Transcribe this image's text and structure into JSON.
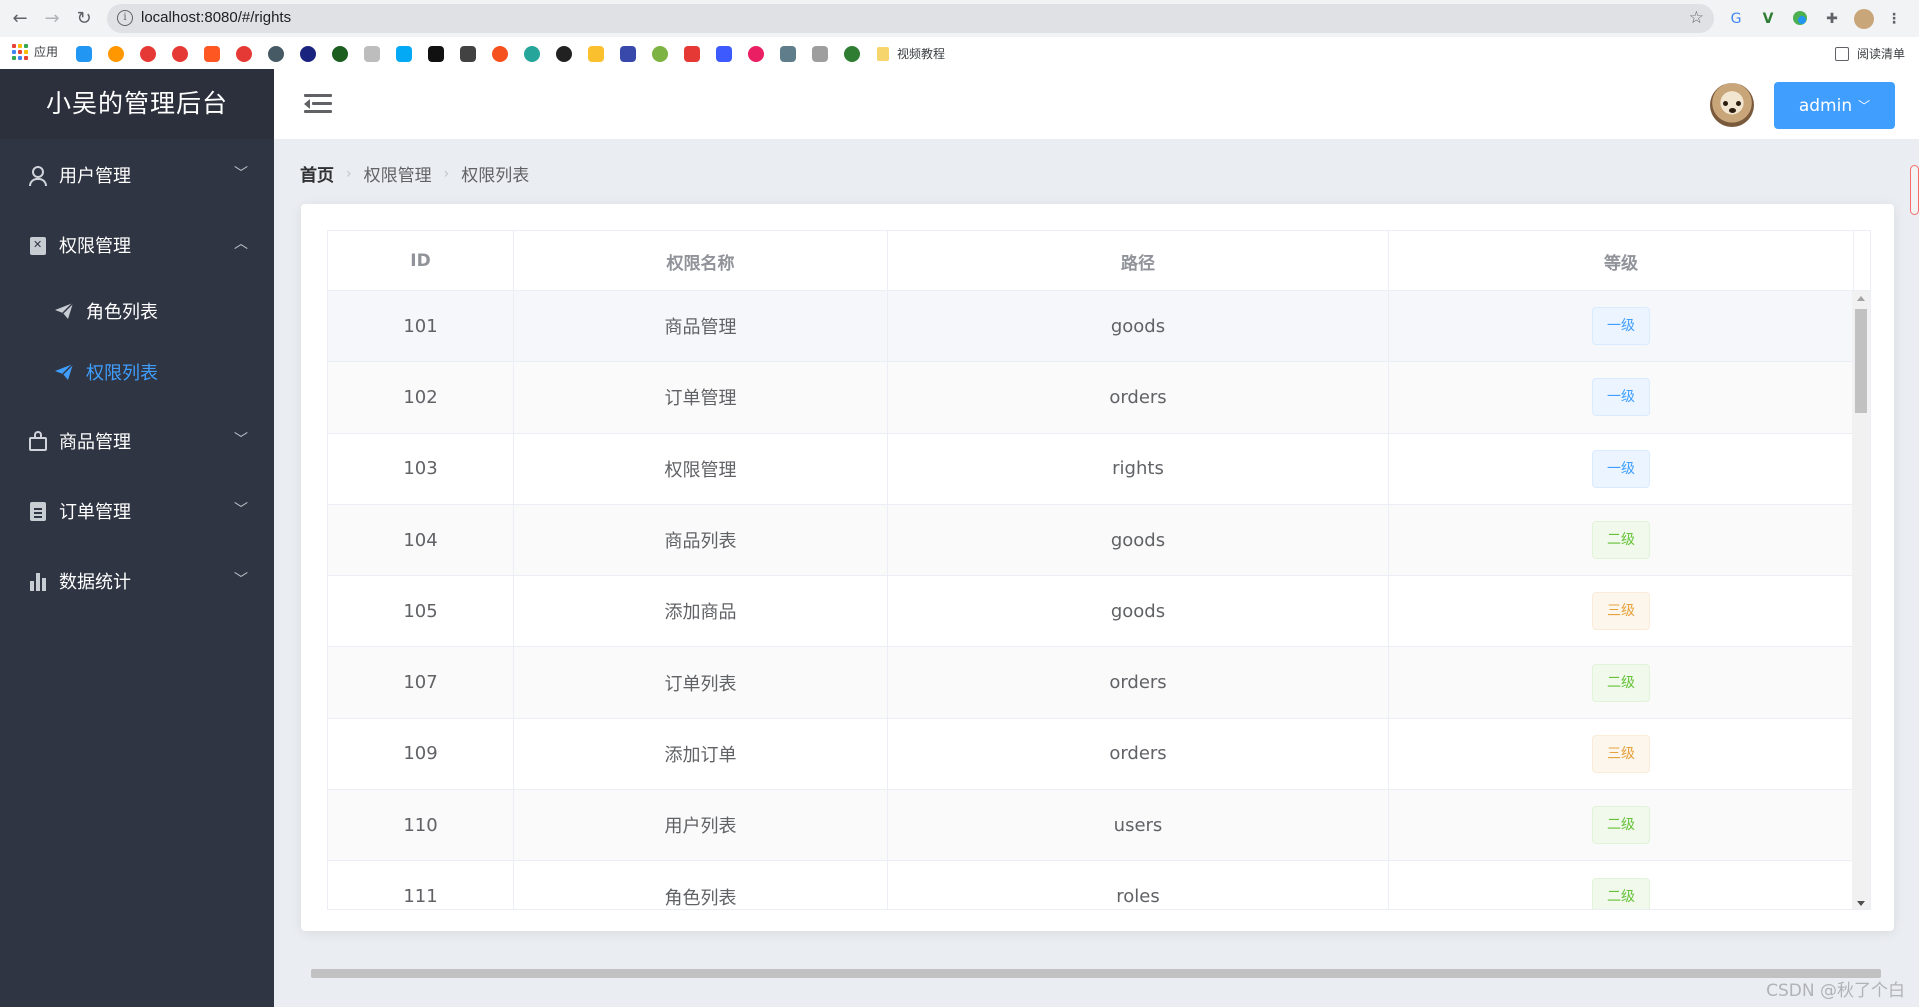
{
  "browser": {
    "url": "localhost:8080/#/rights",
    "apps_label": "应用",
    "bookmark_folder": "视频教程",
    "reading_list": "阅读清单"
  },
  "sidebar": {
    "brand": "小吴的管理后台",
    "menus": [
      {
        "label": "用户管理",
        "icon": "user-icon",
        "expanded": false
      },
      {
        "label": "权限管理",
        "icon": "clipboard-icon",
        "expanded": true,
        "children": [
          {
            "label": "角色列表",
            "icon": "paper-plane-icon",
            "active": false
          },
          {
            "label": "权限列表",
            "icon": "paper-plane-icon",
            "active": true
          }
        ]
      },
      {
        "label": "商品管理",
        "icon": "shopping-bag-icon",
        "expanded": false
      },
      {
        "label": "订单管理",
        "icon": "document-icon",
        "expanded": false
      },
      {
        "label": "数据统计",
        "icon": "bar-chart-icon",
        "expanded": false
      }
    ]
  },
  "header": {
    "user": "admin"
  },
  "breadcrumb": [
    "首页",
    "权限管理",
    "权限列表"
  ],
  "table": {
    "columns": [
      "ID",
      "权限名称",
      "路径",
      "等级"
    ],
    "rows": [
      {
        "id": "101",
        "name": "商品管理",
        "path": "goods",
        "level": "一级",
        "level_num": 1
      },
      {
        "id": "102",
        "name": "订单管理",
        "path": "orders",
        "level": "一级",
        "level_num": 1
      },
      {
        "id": "103",
        "name": "权限管理",
        "path": "rights",
        "level": "一级",
        "level_num": 1
      },
      {
        "id": "104",
        "name": "商品列表",
        "path": "goods",
        "level": "二级",
        "level_num": 2
      },
      {
        "id": "105",
        "name": "添加商品",
        "path": "goods",
        "level": "三级",
        "level_num": 3
      },
      {
        "id": "107",
        "name": "订单列表",
        "path": "orders",
        "level": "二级",
        "level_num": 2
      },
      {
        "id": "109",
        "name": "添加订单",
        "path": "orders",
        "level": "三级",
        "level_num": 3
      },
      {
        "id": "110",
        "name": "用户列表",
        "path": "users",
        "level": "二级",
        "level_num": 2
      },
      {
        "id": "111",
        "name": "角色列表",
        "path": "roles",
        "level": "二级",
        "level_num": 2
      }
    ]
  },
  "watermark": "CSDN @秋了个白",
  "colors": {
    "primary": "#409eff",
    "sidebar_bg": "#2f3542",
    "level1": "#409eff",
    "level2": "#67c23a",
    "level3": "#e6a23c"
  }
}
